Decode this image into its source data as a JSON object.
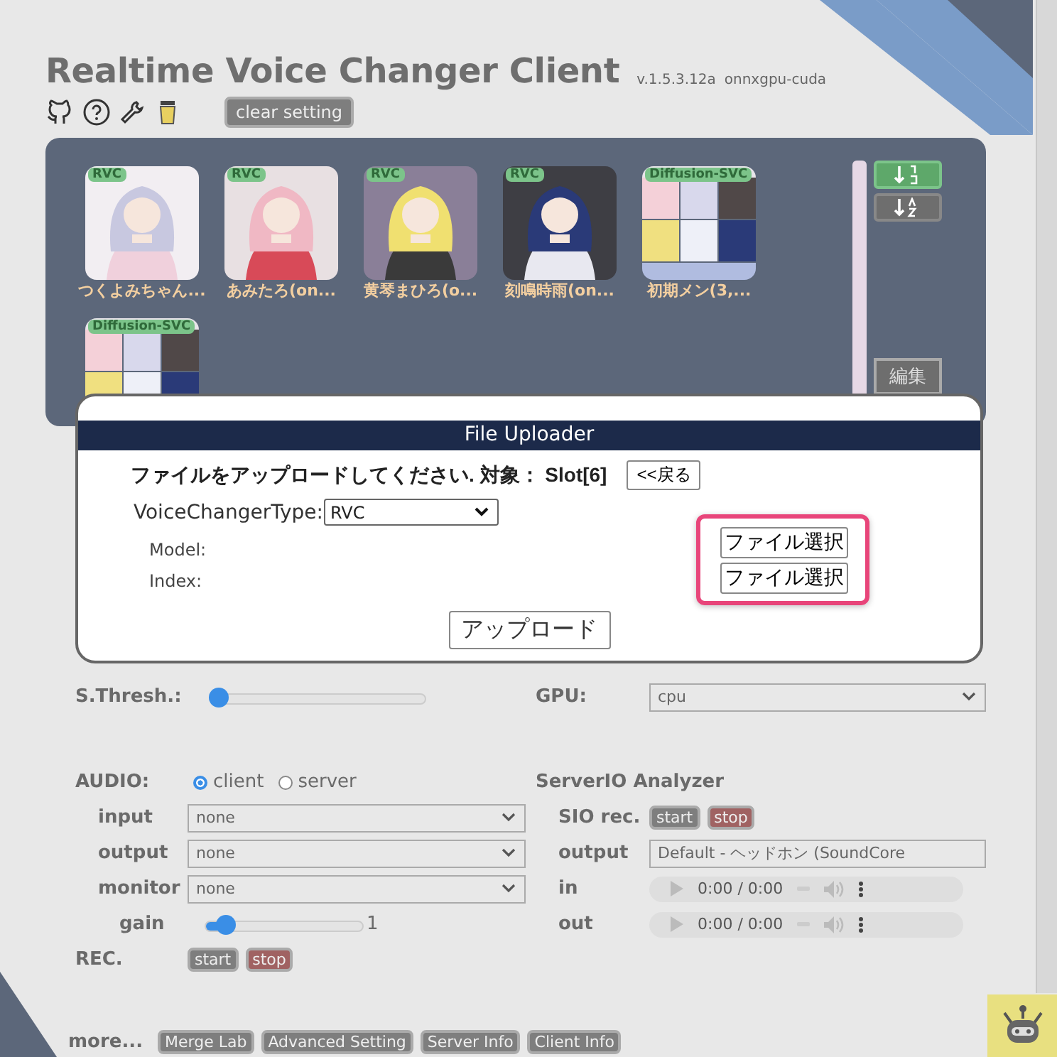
{
  "header": {
    "title": "Realtime Voice Changer Client",
    "version": "v.1.5.3.12a",
    "build": "onnxgpu-cuda",
    "clear_button": "clear setting"
  },
  "slots": [
    {
      "tag": "RVC",
      "label": "つくよみちゃん...",
      "kind": "picture"
    },
    {
      "tag": "RVC",
      "label": "あみたろ(on...",
      "kind": "picture"
    },
    {
      "tag": "RVC",
      "label": "黄琴まひろ(o...",
      "kind": "picture"
    },
    {
      "tag": "RVC",
      "label": "刻鳴時雨(on...",
      "kind": "picture"
    },
    {
      "tag": "Diffusion-SVC",
      "label": "初期メン(3,...",
      "kind": "picture"
    },
    {
      "tag": "Diffusion-SVC",
      "kind": "picture"
    }
  ],
  "sort_buttons": [
    {
      "kind": "numeric",
      "selected": true
    },
    {
      "kind": "alpha",
      "selected": false
    }
  ],
  "edit_button": "編集",
  "uploader": {
    "title": "File Uploader",
    "prompt": "ファイルをアップロードしてください. 対象： Slot[6]",
    "back_button": "<<戻る",
    "type_label": "VoiceChangerType:",
    "type_value": "RVC",
    "files": [
      {
        "label": "Model:",
        "button": "ファイル選択"
      },
      {
        "label": "Index:",
        "button": "ファイル選択"
      }
    ],
    "upload_button": "アップロード"
  },
  "settings": {
    "threshold": {
      "label": "S.Thresh.:",
      "level": 0.0
    },
    "gpu": {
      "label": "GPU:",
      "value": "cpu"
    }
  },
  "audio": {
    "label": "AUDIO:",
    "modes": [
      {
        "label": "client",
        "selected": true
      },
      {
        "label": "server",
        "selected": false
      }
    ],
    "devices": [
      {
        "label": "input",
        "value": "none"
      },
      {
        "label": "output",
        "value": "none"
      },
      {
        "label": "monitor",
        "value": "none"
      }
    ],
    "gain": {
      "label": "gain",
      "level": 0.1,
      "reading": "1"
    },
    "rec": {
      "label": "REC.",
      "buttons": [
        {
          "label": "start",
          "kind": "start"
        },
        {
          "label": "stop",
          "kind": "stop"
        }
      ]
    }
  },
  "analyzer": {
    "title": "ServerIO Analyzer",
    "rec": {
      "label": "SIO rec.",
      "buttons": [
        {
          "label": "start",
          "kind": "start"
        },
        {
          "label": "stop",
          "kind": "stop"
        }
      ]
    },
    "output": {
      "label": "output",
      "value": "Default - ヘッドホン (SoundCore"
    },
    "players": [
      {
        "label": "in",
        "time": "0:00 / 0:00"
      },
      {
        "label": "out",
        "time": "0:00 / 0:00"
      }
    ]
  },
  "more": {
    "label": "more...",
    "buttons": [
      "Merge Lab",
      "Advanced Setting",
      "Server Info",
      "Client Info"
    ]
  }
}
